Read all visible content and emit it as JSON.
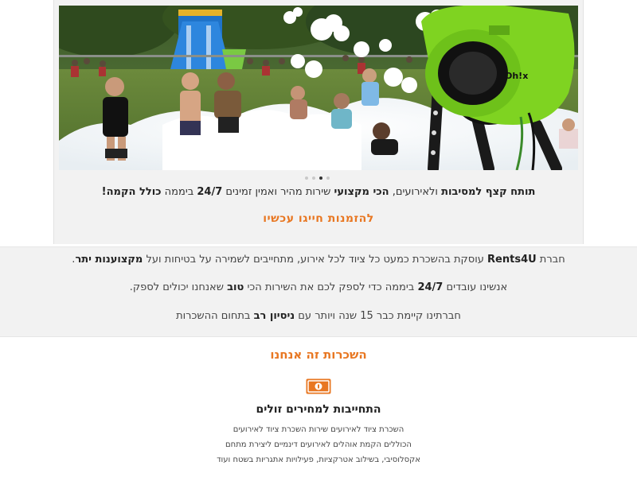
{
  "hero": {
    "image_alt": "foam party with kids and foam cannon",
    "brand_on_machine": "Oh!x"
  },
  "carousel": {
    "count": 4,
    "active_index": 2
  },
  "tagline": {
    "part1": "תותח קצף למסיבות",
    "part2": " ולאירועים, ",
    "part3": "הכי מקצועי",
    "part4": " שירות מהיר ואמין זמינים ",
    "part5": "24/7",
    "part6": " ביממה ",
    "part7": "כולל הקמה!"
  },
  "cta": {
    "label": "להזמנות חייגו עכשיו"
  },
  "about": {
    "p1_a": "חברת ",
    "p1_b": "Rents4U",
    "p1_c": " עוסקת בהשכרת כמעט כל ציוד לכל אירוע, מתחייבים לשמירה על בטיחות ועל ",
    "p1_d": "מקצוענות יתר",
    "p1_e": ".",
    "p2_a": "אנשינו עובדים ",
    "p2_b": "24/7",
    "p2_c": " ביממה כדי לספק לכם את השירות הכי ",
    "p2_d": "טוב",
    "p2_e": " שאנחנו יכולים לספק.",
    "p3_a": "חברתינו קיימת כבר 15 שנה ויותר עם ",
    "p3_b": "ניסיון רב",
    "p3_c": " בתחום ההשכרות"
  },
  "section": {
    "title": "השכרות זה אנחנו"
  },
  "feature": {
    "icon": "money-bill-icon",
    "title": "התחייבות למחירים זולים",
    "line1": "השכרת ציוד לאירועים שירות השכרת ציוד לאירועים",
    "line2": "הכוללים הקמת אוהלים לאירועים דינמיים ליצירת מתחם",
    "line3": "אקסלוסיבי, בשילוב אטרקציות, פעילויות אתגריות בשטח ועוד"
  },
  "colors": {
    "accent": "#e87722",
    "panel": "#f2f2f2",
    "foam_machine": "#7fd321"
  }
}
